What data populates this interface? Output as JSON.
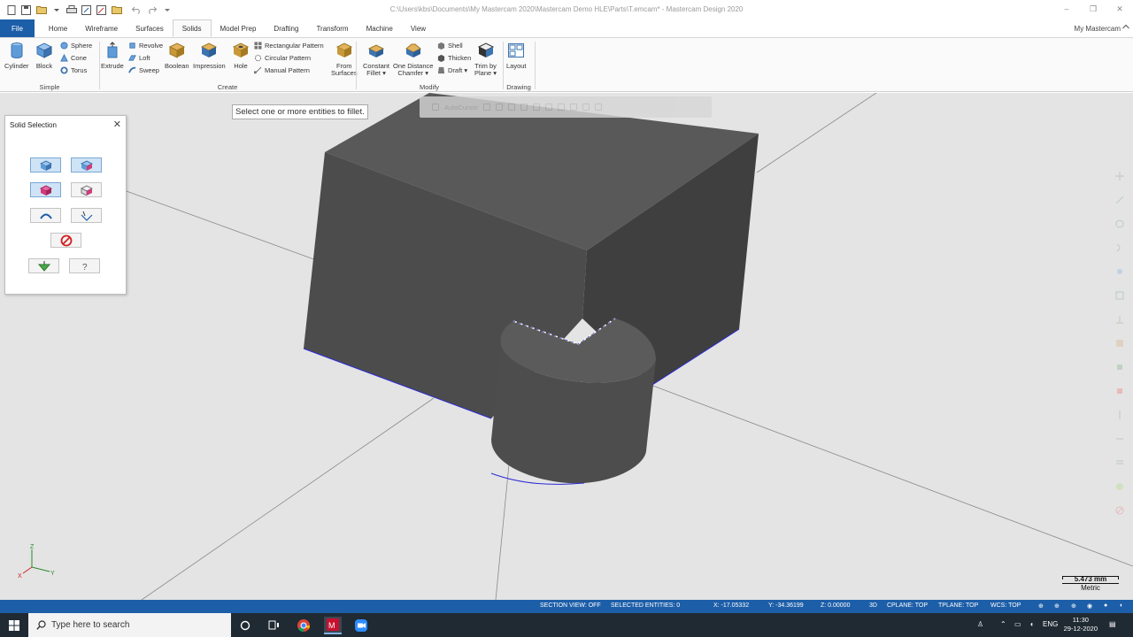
{
  "window": {
    "title": "C:\\Users\\kbs\\Documents\\My Mastercam 2020\\Mastercam Demo HLE\\Parts\\T.emcam* - Mastercam Design 2020",
    "controls": [
      "–",
      "❐",
      "✕"
    ]
  },
  "tabs": {
    "file": "File",
    "items": [
      "Home",
      "Wireframe",
      "Surfaces",
      "Solids",
      "Model Prep",
      "Drafting",
      "Transform",
      "Machine",
      "View"
    ],
    "active": "Solids",
    "my_mastercam": "My Mastercam"
  },
  "ribbon": {
    "simple": {
      "label": "Simple",
      "cylinder": "Cylinder",
      "block": "Block",
      "sphere": "Sphere",
      "cone": "Cone",
      "torus": "Torus"
    },
    "create": {
      "label": "Create",
      "extrude": "Extrude",
      "revolve": "Revolve",
      "loft": "Loft",
      "sweep": "Sweep",
      "boolean": "Boolean",
      "impression": "Impression",
      "hole": "Hole",
      "rectangular_pattern": "Rectangular Pattern",
      "circular_pattern": "Circular Pattern",
      "manual_pattern": "Manual Pattern",
      "from_surfaces_1": "From",
      "from_surfaces_2": "Surfaces"
    },
    "modify": {
      "label": "Modify",
      "constant_fillet_1": "Constant",
      "constant_fillet_2": "Fillet ▾",
      "one_distance_1": "One Distance",
      "one_distance_2": "Chamfer ▾",
      "shell": "Shell",
      "thicken": "Thicken",
      "draft": "Draft ▾",
      "trim_1": "Trim by",
      "trim_2": "Plane ▾"
    },
    "drawing": {
      "label": "Drawing",
      "layout": "Layout"
    }
  },
  "viewport": {
    "prompt": "Select one or more entities to fillet.",
    "autocursor": "AutoCursor",
    "colors": {
      "background": "#e4e4e4",
      "solid_top": "#595959",
      "solid_front": "#4c4c4c",
      "solid_side": "#3f3f3f",
      "edge_highlight": "#2b2bd6"
    }
  },
  "panel": {
    "title": "Solid Selection",
    "buttons": [
      "body-select-icon",
      "face-select-icon",
      "edge-select-icon",
      "feature-select-icon",
      "loop-select-icon",
      "vertex-select-icon",
      "clear-icon",
      "accept-icon",
      "help-icon"
    ]
  },
  "triad": {
    "z": "Z",
    "y": "Y",
    "x": "X"
  },
  "scale": {
    "value": "5.473 mm",
    "unit": "Metric"
  },
  "statusbar": {
    "section_view": "SECTION VIEW: OFF",
    "selected": "SELECTED ENTITIES: 0",
    "x": "X:   -17.05332",
    "y": "Y:   -34.36199",
    "z": "Z:   0.00000",
    "mode": "3D",
    "cplane": "CPLANE: TOP",
    "tplane": "TPLANE: TOP",
    "wcs": "WCS: TOP"
  },
  "taskbar": {
    "search": "Type here to search",
    "lang": "ENG",
    "time": "11:30",
    "date": "29-12-2020"
  }
}
